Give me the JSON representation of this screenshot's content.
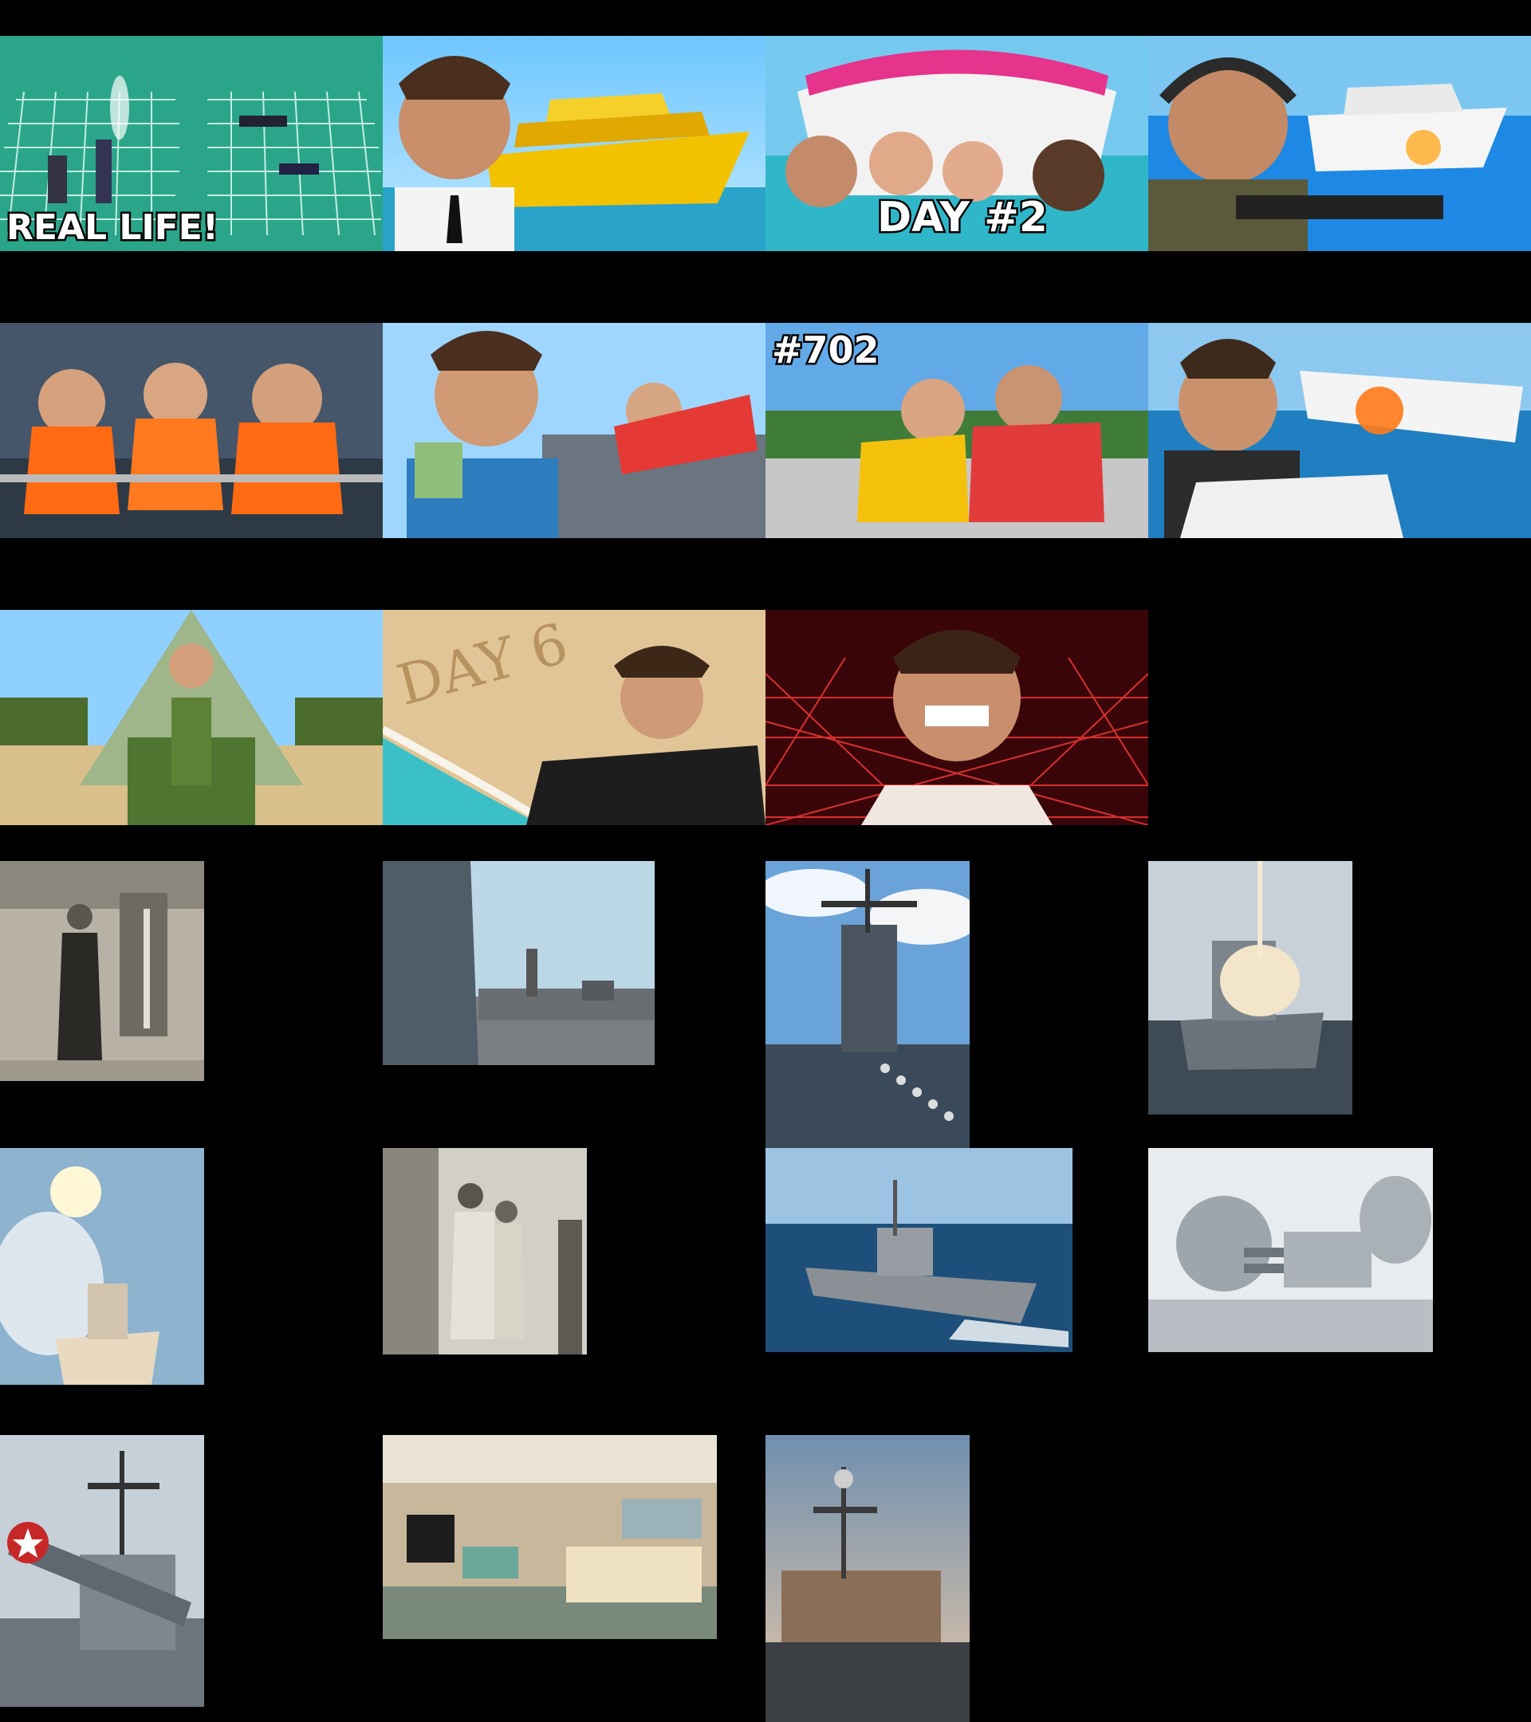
{
  "page": {
    "background": "#000000"
  },
  "video_thumbnails": [
    {
      "id": "battleship-real-life",
      "caption": "REAL LIFE!",
      "accent": "#2aa58a"
    },
    {
      "id": "golden-yacht",
      "caption": "",
      "accent": "#f2c200"
    },
    {
      "id": "stranded-boat",
      "caption": "DAY #2",
      "accent": "#e6338c"
    },
    {
      "id": "yacht-gunner",
      "caption": "",
      "accent": "#1e88e5"
    },
    {
      "id": "life-vests",
      "caption": "",
      "accent": "#ff6a13"
    },
    {
      "id": "ship-money",
      "caption": "",
      "accent": "#2d7dbf"
    },
    {
      "id": "rollercoaster-702",
      "caption": "#702",
      "accent": "#e23b3b"
    },
    {
      "id": "plane-crash-ocean",
      "caption": "",
      "accent": "#1f7fc0"
    },
    {
      "id": "tank-money",
      "caption": "",
      "accent": "#4a6b2c"
    },
    {
      "id": "day-6-sand",
      "caption": "DAY 6",
      "accent": "#e2c596"
    },
    {
      "id": "laser-grid",
      "caption": "",
      "accent": "#d51d25"
    }
  ],
  "photo_thumbnails": [
    {
      "id": "officer-vintage-photo",
      "kind": "vintage"
    },
    {
      "id": "battleship-deck-photo",
      "kind": "deck"
    },
    {
      "id": "carrier-crowd-photo",
      "kind": "carrier-crowd"
    },
    {
      "id": "missile-launch-photo",
      "kind": "missile"
    },
    {
      "id": "missile-night-photo",
      "kind": "missile-sky"
    },
    {
      "id": "officers-vintage-photo",
      "kind": "vintage"
    },
    {
      "id": "cruiser-sea-photo",
      "kind": "cruiser"
    },
    {
      "id": "gun-turret-photo",
      "kind": "turret"
    },
    {
      "id": "cannon-star-photo",
      "kind": "cannon"
    },
    {
      "id": "ship-lounge-photo",
      "kind": "lounge"
    },
    {
      "id": "carrier-sunset-photo",
      "kind": "carrier-dusk"
    }
  ]
}
